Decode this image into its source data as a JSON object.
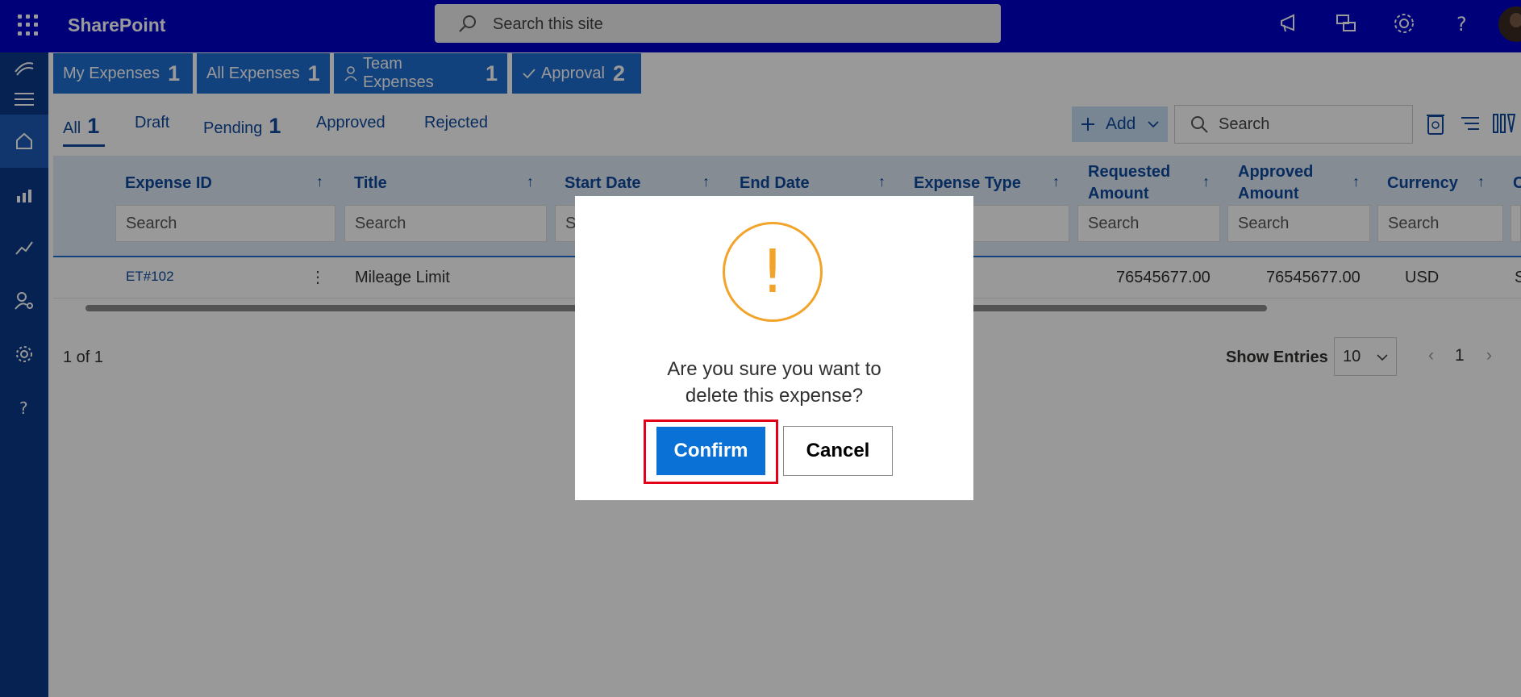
{
  "header": {
    "brand": "SharePoint",
    "search_placeholder": "Search this site",
    "icons": [
      "megaphone-icon",
      "chat-icon",
      "gear-icon",
      "help-icon"
    ]
  },
  "rail": {
    "items": [
      "logo-icon",
      "menu-icon",
      "home-icon",
      "analytics-icon",
      "trend-icon",
      "user-settings-icon",
      "settings-icon",
      "help-icon"
    ]
  },
  "tabs": [
    {
      "label": "My Expenses",
      "count": "1"
    },
    {
      "label": "All Expenses",
      "count": "1"
    },
    {
      "label": "Team Expenses",
      "count": "1"
    },
    {
      "label": "Approval",
      "count": "2"
    }
  ],
  "subtabs": [
    {
      "label": "All",
      "count": "1"
    },
    {
      "label": "Draft",
      "count": ""
    },
    {
      "label": "Pending",
      "count": "1"
    },
    {
      "label": "Approved",
      "count": ""
    },
    {
      "label": "Rejected",
      "count": ""
    }
  ],
  "toolbar": {
    "add_label": "Add",
    "search_placeholder": "Search"
  },
  "grid": {
    "columns": [
      {
        "label": "Expense ID"
      },
      {
        "label": "Title"
      },
      {
        "label": "Start Date"
      },
      {
        "label": "End Date"
      },
      {
        "label": "Expense Type"
      },
      {
        "label": "Requested Amount"
      },
      {
        "label": "Approved Amount"
      },
      {
        "label": "Currency"
      },
      {
        "label": "C"
      }
    ],
    "filter_placeholder": "Search",
    "rows": [
      {
        "id": "ET#102",
        "title": "Mileage Limit",
        "requested": "76545677.00",
        "approved": "76545677.00",
        "currency": "USD",
        "partial": "S"
      }
    ]
  },
  "footer": {
    "page_info": "1 of 1",
    "show_entries_label": "Show Entries",
    "entries_value": "10",
    "current_page": "1"
  },
  "dialog": {
    "icon_glyph": "!",
    "message_line1": "Are you sure you want to",
    "message_line2": "delete this expense?",
    "confirm_label": "Confirm",
    "cancel_label": "Cancel"
  },
  "colors": {
    "topbar": "#0000c9",
    "rail": "#0a3a8a",
    "accent": "#1f6fd0",
    "warning": "#f2a32a",
    "focus_ring": "#e5001a"
  }
}
